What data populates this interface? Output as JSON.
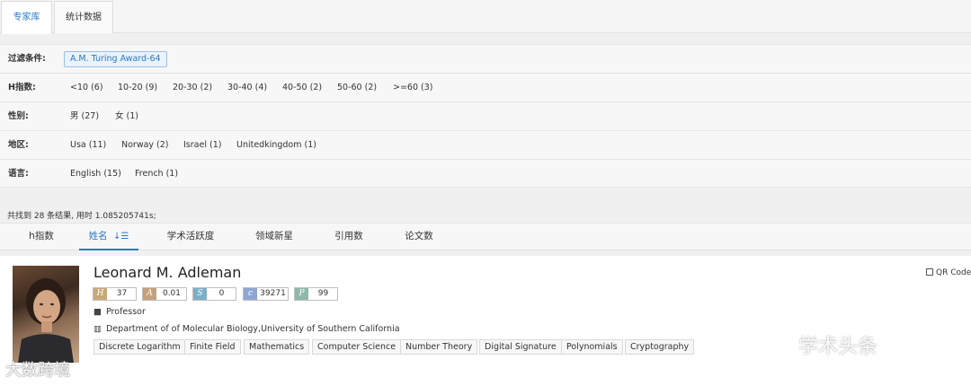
{
  "tabs": [
    "专家库",
    "统计数据"
  ],
  "filters": {
    "condition_label": "过滤条件:",
    "condition_tag": "A.M. Turing Award-64",
    "hindex": {
      "label": "H指数:",
      "options": [
        "<10 (6)",
        "10-20 (9)",
        "20-30 (2)",
        "30-40 (4)",
        "40-50 (2)",
        "50-60 (2)",
        ">=60 (3)"
      ]
    },
    "gender": {
      "label": "性别:",
      "options": [
        "男 (27)",
        "女 (1)"
      ]
    },
    "region": {
      "label": "地区:",
      "options": [
        "Usa (11)",
        "Norway (2)",
        "Israel (1)",
        "Unitedkingdom (1)"
      ]
    },
    "language": {
      "label": "语言:",
      "options": [
        "English (15)",
        "French (1)"
      ]
    }
  },
  "result_summary": "共找到 28 条结果, 用时 1.085205741s;",
  "sort_tabs": [
    "h指数",
    "姓名",
    "学术活跃度",
    "领域新星",
    "引用数",
    "论文数"
  ],
  "sort_active_icon": "sort-desc-icon",
  "expert": {
    "name": "Leonard M. Adleman",
    "qr_label": "QR Code",
    "metrics": [
      {
        "icon": "H",
        "value": "37",
        "color": "#c8a878"
      },
      {
        "icon": "A",
        "value": "0.01",
        "color": "#c3a17a"
      },
      {
        "icon": "S",
        "value": "0",
        "color": "#7bb0c9"
      },
      {
        "icon": "c",
        "value": "39271",
        "color": "#8fa6d2"
      },
      {
        "icon": "P",
        "value": "99",
        "color": "#8fb9a8"
      }
    ],
    "title": "Professor",
    "affiliation": "Department of of Molecular Biology,University of Southern California",
    "keywords": [
      "Discrete Logarithm",
      "Finite Field",
      "Mathematics",
      "Computer Science",
      "Number Theory",
      "Digital Signature",
      "Polynomials",
      "Cryptography"
    ]
  },
  "watermarks": {
    "right": "学术头条",
    "left": "大数跨境"
  }
}
